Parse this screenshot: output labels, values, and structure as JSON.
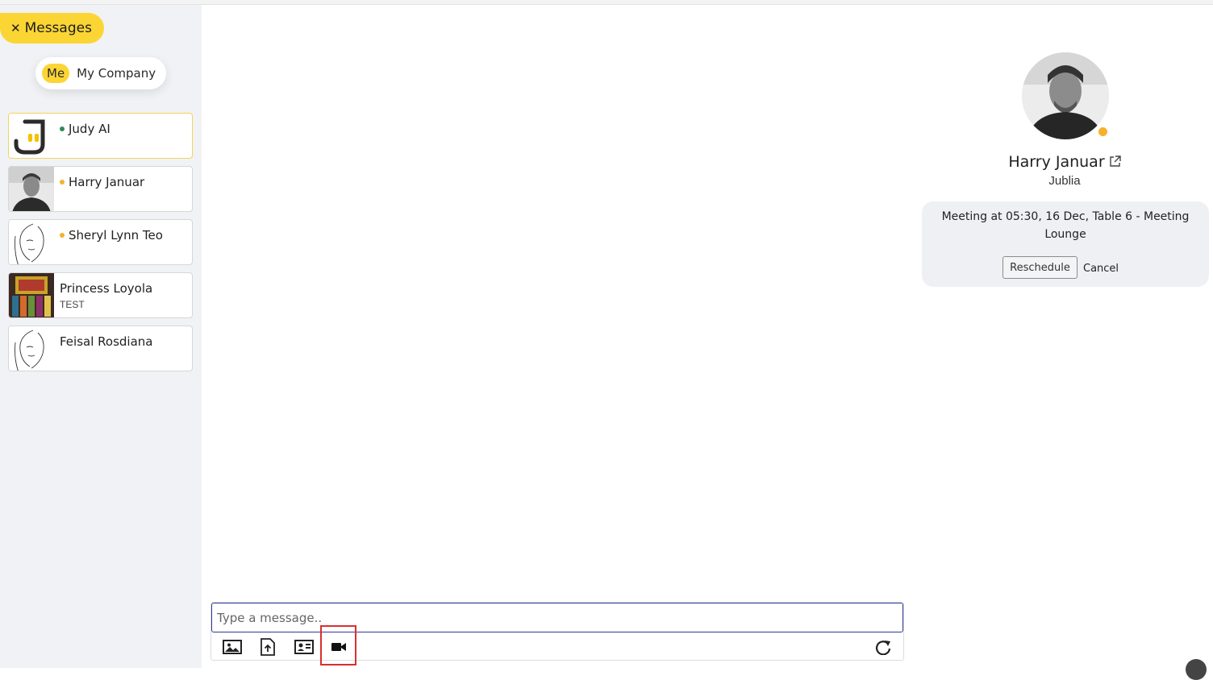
{
  "header": {
    "messages_label": "Messages"
  },
  "tabs": {
    "me": "Me",
    "company": "My Company"
  },
  "contacts": [
    {
      "name": "Judy AI",
      "sub": "",
      "status_color": "#2e8b57",
      "avatar_icon": "judy-logo-icon"
    },
    {
      "name": "Harry Januar",
      "sub": "",
      "status_color": "#f6b12c",
      "avatar_icon": "photo-avatar"
    },
    {
      "name": "Sheryl Lynn Teo",
      "sub": "",
      "status_color": "#f6b12c",
      "avatar_icon": "line-art-face-avatar"
    },
    {
      "name": "Princess Loyola",
      "sub": "TEST",
      "status_color": "",
      "avatar_icon": "painting-avatar"
    },
    {
      "name": "Feisal Rosdiana",
      "sub": "",
      "status_color": "",
      "avatar_icon": "line-art-face-avatar"
    }
  ],
  "composer": {
    "placeholder": "Type a message..",
    "tools": [
      "image-icon",
      "upload-file-icon",
      "contact-card-icon",
      "video-camera-icon",
      "refresh-icon"
    ]
  },
  "profile": {
    "name": "Harry Januar",
    "company": "Jublia",
    "status_color": "#f6b12c",
    "meeting_text": "Meeting at 05:30, 16 Dec, Table 6 - Meeting Lounge",
    "reschedule_label": "Reschedule",
    "cancel_label": "Cancel"
  },
  "colors": {
    "accent": "#fbd534",
    "sidebar_bg": "#f0f2f5",
    "highlight": "#d93030",
    "input_border": "#2e3a9a"
  }
}
